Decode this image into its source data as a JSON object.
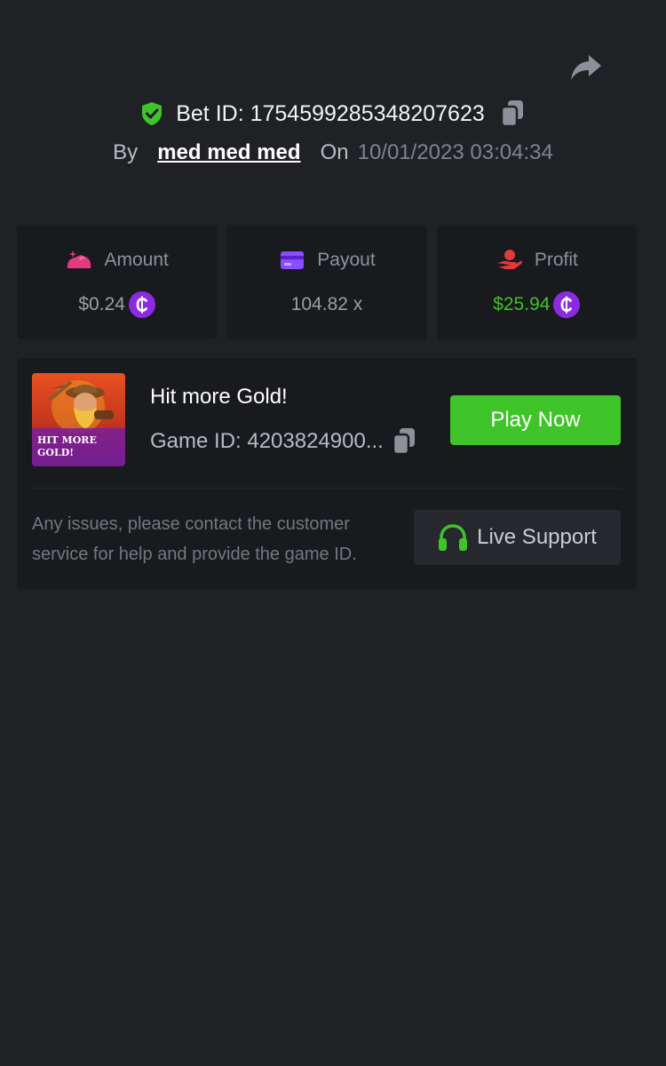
{
  "header": {
    "bet_label": "Bet ID: 1754599285348207623",
    "by_label": "By",
    "username": "med med med",
    "on_label": "On",
    "datetime": "10/01/2023 03:04:34"
  },
  "stats": [
    {
      "label": "Amount",
      "value": "$0.24",
      "icon": "money-bag-icon",
      "accent": "#e23a7a",
      "currency_icon": "coin-icon"
    },
    {
      "label": "Payout",
      "value": "104.82 x",
      "icon": "card-icon",
      "accent": "#8a4dff"
    },
    {
      "label": "Profit",
      "value": "$25.94",
      "icon": "hand-money-icon",
      "accent": "#e23a3a",
      "currency_icon": "coin-icon",
      "value_color": "#3ec22a"
    }
  ],
  "game": {
    "title": "Hit more Gold!",
    "id_label": "Game ID: 4203824900...",
    "thumbnail_text": "HIT MORE GOLD!",
    "play_label": "Play Now"
  },
  "support": {
    "help_text": "Any issues, please contact the customer service for help and provide the game ID.",
    "button_label": "Live Support"
  },
  "colors": {
    "background": "#202125",
    "card": "#191a1e",
    "green": "#3fc429",
    "coin_purple": "#8a2be2"
  }
}
